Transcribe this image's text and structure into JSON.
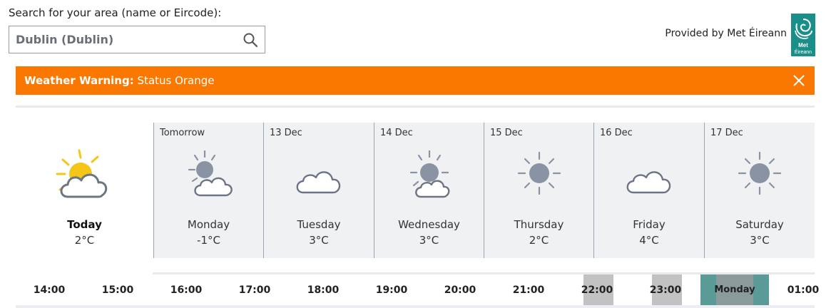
{
  "search": {
    "label": "Search for your area (name or Eircode):",
    "value": "Dublin (Dublin)"
  },
  "provider": {
    "text": "Provided by Met Éireann",
    "logo_text": "Met Éireann"
  },
  "warning": {
    "title": "Weather Warning:",
    "status": "Status Orange",
    "color": "#fa7800"
  },
  "today": {
    "name": "Today",
    "temp": "2°C",
    "icon": "sun-cloud-icon"
  },
  "days": [
    {
      "date": "Tomorrow",
      "name": "Monday",
      "temp": "-1°C",
      "icon": "sun-cloud-icon"
    },
    {
      "date": "13 Dec",
      "name": "Tuesday",
      "temp": "3°C",
      "icon": "cloud-icon"
    },
    {
      "date": "14 Dec",
      "name": "Wednesday",
      "temp": "3°C",
      "icon": "sun-cloud-icon"
    },
    {
      "date": "15 Dec",
      "name": "Thursday",
      "temp": "2°C",
      "icon": "sun-icon"
    },
    {
      "date": "16 Dec",
      "name": "Friday",
      "temp": "4°C",
      "icon": "cloud-icon"
    },
    {
      "date": "17 Dec",
      "name": "Saturday",
      "temp": "3°C",
      "icon": "sun-icon"
    }
  ],
  "hours": [
    "14:00",
    "15:00",
    "16:00",
    "17:00",
    "18:00",
    "19:00",
    "20:00",
    "21:00",
    "22:00",
    "23:00",
    "Monday",
    "01:00"
  ],
  "colors": {
    "accent": "#fa7800",
    "day_panel": "#f0f1f3",
    "selected": "#5a9a97",
    "highlight": "#c2c2c2"
  }
}
